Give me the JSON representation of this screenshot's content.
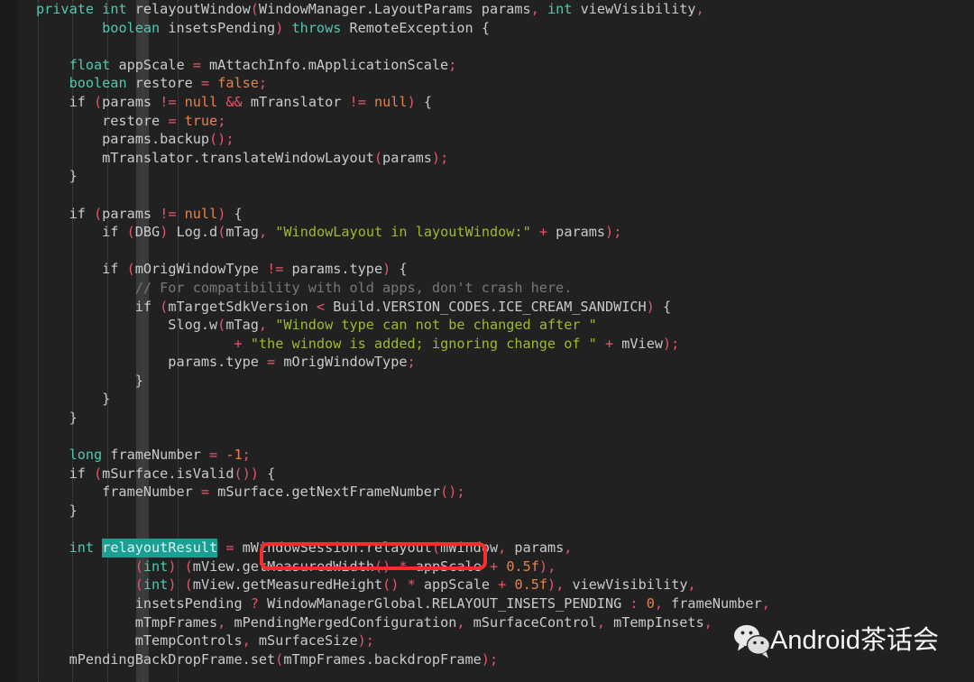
{
  "editor": {
    "background": "#212121",
    "gutter_color": "#1b1b1b",
    "vertical_bar_color": "#3a3a3a",
    "font_size_px": 15,
    "line_height_px": 20.6
  },
  "palette": {
    "keyword": "#4ec9b0",
    "punctuation": "#e8566b",
    "literal": "#e8814a",
    "string": "#9bbb2e",
    "comment": "#787878",
    "plain": "#c8cbcd",
    "selection_highlight": "#1d9e93",
    "annotation_red": "#ff2b2b"
  },
  "annotations": {
    "highlight_token": "relayoutResult",
    "boxed_expression": "mWindowSession.relayout"
  },
  "watermark": {
    "icon": "wechat-icon",
    "text": "Android茶话会",
    "color": "#ffffff"
  },
  "code": {
    "language": "java",
    "lines": [
      "private int relayoutWindow(WindowManager.LayoutParams params, int viewVisibility,",
      "        boolean insetsPending) throws RemoteException {",
      "",
      "    float appScale = mAttachInfo.mApplicationScale;",
      "    boolean restore = false;",
      "    if (params != null && mTranslator != null) {",
      "        restore = true;",
      "        params.backup();",
      "        mTranslator.translateWindowLayout(params);",
      "    }",
      "",
      "    if (params != null) {",
      "        if (DBG) Log.d(mTag, \"WindowLayout in layoutWindow:\" + params);",
      "",
      "        if (mOrigWindowType != params.type) {",
      "            // For compatibility with old apps, don't crash here.",
      "            if (mTargetSdkVersion < Build.VERSION_CODES.ICE_CREAM_SANDWICH) {",
      "                Slog.w(mTag, \"Window type can not be changed after \"",
      "                        + \"the window is added; ignoring change of \" + mView);",
      "                params.type = mOrigWindowType;",
      "            }",
      "        }",
      "    }",
      "",
      "    long frameNumber = -1;",
      "    if (mSurface.isValid()) {",
      "        frameNumber = mSurface.getNextFrameNumber();",
      "    }",
      "",
      "    int relayoutResult = mWindowSession.relayout(mWindow, params,",
      "            (int) (mView.getMeasuredWidth() * appScale + 0.5f),",
      "            (int) (mView.getMeasuredHeight() * appScale + 0.5f), viewVisibility,",
      "            insetsPending ? WindowManagerGlobal.RELAYOUT_INSETS_PENDING : 0, frameNumber,",
      "            mTmpFrames, mPendingMergedConfiguration, mSurfaceControl, mTempInsets,",
      "            mTempControls, mSurfaceSize);",
      "    mPendingBackDropFrame.set(mTmpFrames.backdropFrame);"
    ],
    "tokens": [
      [
        {
          "t": "private",
          "c": "kw"
        },
        {
          "t": " ",
          "c": "pln"
        },
        {
          "t": "int",
          "c": "kw"
        },
        {
          "t": " relayoutWindow",
          "c": "pln"
        },
        {
          "t": "(",
          "c": "punc"
        },
        {
          "t": "WindowManager.LayoutParams params",
          "c": "pln"
        },
        {
          "t": ",",
          "c": "punc"
        },
        {
          "t": " ",
          "c": "pln"
        },
        {
          "t": "int",
          "c": "kw"
        },
        {
          "t": " viewVisibility",
          "c": "pln"
        },
        {
          "t": ",",
          "c": "punc"
        }
      ],
      [
        {
          "t": "        ",
          "c": "pln"
        },
        {
          "t": "boolean",
          "c": "kw"
        },
        {
          "t": " insetsPending",
          "c": "pln"
        },
        {
          "t": ")",
          "c": "punc"
        },
        {
          "t": " ",
          "c": "pln"
        },
        {
          "t": "throws",
          "c": "kw"
        },
        {
          "t": " RemoteException {",
          "c": "pln"
        }
      ],
      [],
      [
        {
          "t": "    ",
          "c": "pln"
        },
        {
          "t": "float",
          "c": "kw"
        },
        {
          "t": " appScale ",
          "c": "pln"
        },
        {
          "t": "=",
          "c": "punc"
        },
        {
          "t": " mAttachInfo.mApplicationScale",
          "c": "pln"
        },
        {
          "t": ";",
          "c": "punc"
        }
      ],
      [
        {
          "t": "    ",
          "c": "pln"
        },
        {
          "t": "boolean",
          "c": "kw"
        },
        {
          "t": " restore ",
          "c": "pln"
        },
        {
          "t": "=",
          "c": "punc"
        },
        {
          "t": " ",
          "c": "pln"
        },
        {
          "t": "false",
          "c": "lit"
        },
        {
          "t": ";",
          "c": "punc"
        }
      ],
      [
        {
          "t": "    if ",
          "c": "pln"
        },
        {
          "t": "(",
          "c": "punc"
        },
        {
          "t": "params ",
          "c": "pln"
        },
        {
          "t": "!=",
          "c": "punc"
        },
        {
          "t": " ",
          "c": "pln"
        },
        {
          "t": "null",
          "c": "lit"
        },
        {
          "t": " ",
          "c": "pln"
        },
        {
          "t": "&&",
          "c": "punc"
        },
        {
          "t": " mTranslator ",
          "c": "pln"
        },
        {
          "t": "!=",
          "c": "punc"
        },
        {
          "t": " ",
          "c": "pln"
        },
        {
          "t": "null",
          "c": "lit"
        },
        {
          "t": ")",
          "c": "punc"
        },
        {
          "t": " {",
          "c": "pln"
        }
      ],
      [
        {
          "t": "        restore ",
          "c": "pln"
        },
        {
          "t": "=",
          "c": "punc"
        },
        {
          "t": " ",
          "c": "pln"
        },
        {
          "t": "true",
          "c": "lit"
        },
        {
          "t": ";",
          "c": "punc"
        }
      ],
      [
        {
          "t": "        params.backup",
          "c": "pln"
        },
        {
          "t": "()",
          "c": "punc"
        },
        {
          "t": ";",
          "c": "punc"
        }
      ],
      [
        {
          "t": "        mTranslator.translateWindowLayout",
          "c": "pln"
        },
        {
          "t": "(",
          "c": "punc"
        },
        {
          "t": "params",
          "c": "pln"
        },
        {
          "t": ")",
          "c": "punc"
        },
        {
          "t": ";",
          "c": "punc"
        }
      ],
      [
        {
          "t": "    }",
          "c": "pln"
        }
      ],
      [],
      [
        {
          "t": "    if ",
          "c": "pln"
        },
        {
          "t": "(",
          "c": "punc"
        },
        {
          "t": "params ",
          "c": "pln"
        },
        {
          "t": "!=",
          "c": "punc"
        },
        {
          "t": " ",
          "c": "pln"
        },
        {
          "t": "null",
          "c": "lit"
        },
        {
          "t": ")",
          "c": "punc"
        },
        {
          "t": " {",
          "c": "pln"
        }
      ],
      [
        {
          "t": "        if ",
          "c": "pln"
        },
        {
          "t": "(",
          "c": "punc"
        },
        {
          "t": "DBG",
          "c": "pln"
        },
        {
          "t": ")",
          "c": "punc"
        },
        {
          "t": " Log.d",
          "c": "pln"
        },
        {
          "t": "(",
          "c": "punc"
        },
        {
          "t": "mTag",
          "c": "pln"
        },
        {
          "t": ",",
          "c": "punc"
        },
        {
          "t": " ",
          "c": "pln"
        },
        {
          "t": "\"WindowLayout in layoutWindow:\"",
          "c": "str"
        },
        {
          "t": " ",
          "c": "pln"
        },
        {
          "t": "+",
          "c": "punc"
        },
        {
          "t": " params",
          "c": "pln"
        },
        {
          "t": ")",
          "c": "punc"
        },
        {
          "t": ";",
          "c": "punc"
        }
      ],
      [],
      [
        {
          "t": "        if ",
          "c": "pln"
        },
        {
          "t": "(",
          "c": "punc"
        },
        {
          "t": "mOrigWindowType ",
          "c": "pln"
        },
        {
          "t": "!=",
          "c": "punc"
        },
        {
          "t": " params.type",
          "c": "pln"
        },
        {
          "t": ")",
          "c": "punc"
        },
        {
          "t": " {",
          "c": "pln"
        }
      ],
      [
        {
          "t": "            // For compatibility with old apps, don't crash here.",
          "c": "cmt"
        }
      ],
      [
        {
          "t": "            if ",
          "c": "pln"
        },
        {
          "t": "(",
          "c": "punc"
        },
        {
          "t": "mTargetSdkVersion ",
          "c": "pln"
        },
        {
          "t": "<",
          "c": "punc"
        },
        {
          "t": " Build.VERSION_CODES.ICE_CREAM_SANDWICH",
          "c": "pln"
        },
        {
          "t": ")",
          "c": "punc"
        },
        {
          "t": " {",
          "c": "pln"
        }
      ],
      [
        {
          "t": "                Slog.w",
          "c": "pln"
        },
        {
          "t": "(",
          "c": "punc"
        },
        {
          "t": "mTag",
          "c": "pln"
        },
        {
          "t": ",",
          "c": "punc"
        },
        {
          "t": " ",
          "c": "pln"
        },
        {
          "t": "\"Window type can not be changed after \"",
          "c": "str"
        }
      ],
      [
        {
          "t": "                        ",
          "c": "pln"
        },
        {
          "t": "+",
          "c": "punc"
        },
        {
          "t": " ",
          "c": "pln"
        },
        {
          "t": "\"the window is added; ignoring change of \"",
          "c": "str"
        },
        {
          "t": " ",
          "c": "pln"
        },
        {
          "t": "+",
          "c": "punc"
        },
        {
          "t": " mView",
          "c": "pln"
        },
        {
          "t": ")",
          "c": "punc"
        },
        {
          "t": ";",
          "c": "punc"
        }
      ],
      [
        {
          "t": "                params.type ",
          "c": "pln"
        },
        {
          "t": "=",
          "c": "punc"
        },
        {
          "t": " mOrigWindowType",
          "c": "pln"
        },
        {
          "t": ";",
          "c": "punc"
        }
      ],
      [
        {
          "t": "            }",
          "c": "pln"
        }
      ],
      [
        {
          "t": "        }",
          "c": "pln"
        }
      ],
      [
        {
          "t": "    }",
          "c": "pln"
        }
      ],
      [],
      [
        {
          "t": "    ",
          "c": "pln"
        },
        {
          "t": "long",
          "c": "kw"
        },
        {
          "t": " frameNumber ",
          "c": "pln"
        },
        {
          "t": "=",
          "c": "punc"
        },
        {
          "t": " ",
          "c": "pln"
        },
        {
          "t": "-1",
          "c": "lit"
        },
        {
          "t": ";",
          "c": "punc"
        }
      ],
      [
        {
          "t": "    if ",
          "c": "pln"
        },
        {
          "t": "(",
          "c": "punc"
        },
        {
          "t": "mSurface.isValid",
          "c": "pln"
        },
        {
          "t": "()",
          "c": "punc"
        },
        {
          "t": ")",
          "c": "punc"
        },
        {
          "t": " {",
          "c": "pln"
        }
      ],
      [
        {
          "t": "        frameNumber ",
          "c": "pln"
        },
        {
          "t": "=",
          "c": "punc"
        },
        {
          "t": " mSurface.getNextFrameNumber",
          "c": "pln"
        },
        {
          "t": "()",
          "c": "punc"
        },
        {
          "t": ";",
          "c": "punc"
        }
      ],
      [
        {
          "t": "    }",
          "c": "pln"
        }
      ],
      [],
      [
        {
          "t": "    ",
          "c": "pln"
        },
        {
          "t": "int",
          "c": "kw"
        },
        {
          "t": " ",
          "c": "pln"
        },
        {
          "t": "relayoutResult",
          "c": "sel"
        },
        {
          "t": " ",
          "c": "pln"
        },
        {
          "t": "=",
          "c": "punc"
        },
        {
          "t": " mWindowSession.relayout",
          "c": "pln"
        },
        {
          "t": "(",
          "c": "punc"
        },
        {
          "t": "mWindow",
          "c": "pln"
        },
        {
          "t": ",",
          "c": "punc"
        },
        {
          "t": " params",
          "c": "pln"
        },
        {
          "t": ",",
          "c": "punc"
        }
      ],
      [
        {
          "t": "            ",
          "c": "pln"
        },
        {
          "t": "(",
          "c": "punc"
        },
        {
          "t": "int",
          "c": "kw"
        },
        {
          "t": ")",
          "c": "punc"
        },
        {
          "t": " ",
          "c": "pln"
        },
        {
          "t": "(",
          "c": "punc"
        },
        {
          "t": "mView.getMeasuredWidth",
          "c": "pln"
        },
        {
          "t": "()",
          "c": "punc"
        },
        {
          "t": " ",
          "c": "pln"
        },
        {
          "t": "*",
          "c": "punc"
        },
        {
          "t": " appScale ",
          "c": "pln"
        },
        {
          "t": "+",
          "c": "punc"
        },
        {
          "t": " ",
          "c": "pln"
        },
        {
          "t": "0.5f",
          "c": "lit"
        },
        {
          "t": ")",
          "c": "punc"
        },
        {
          "t": ",",
          "c": "punc"
        }
      ],
      [
        {
          "t": "            ",
          "c": "pln"
        },
        {
          "t": "(",
          "c": "punc"
        },
        {
          "t": "int",
          "c": "kw"
        },
        {
          "t": ")",
          "c": "punc"
        },
        {
          "t": " ",
          "c": "pln"
        },
        {
          "t": "(",
          "c": "punc"
        },
        {
          "t": "mView.getMeasuredHeight",
          "c": "pln"
        },
        {
          "t": "()",
          "c": "punc"
        },
        {
          "t": " ",
          "c": "pln"
        },
        {
          "t": "*",
          "c": "punc"
        },
        {
          "t": " appScale ",
          "c": "pln"
        },
        {
          "t": "+",
          "c": "punc"
        },
        {
          "t": " ",
          "c": "pln"
        },
        {
          "t": "0.5f",
          "c": "lit"
        },
        {
          "t": ")",
          "c": "punc"
        },
        {
          "t": ",",
          "c": "punc"
        },
        {
          "t": " viewVisibility",
          "c": "pln"
        },
        {
          "t": ",",
          "c": "punc"
        }
      ],
      [
        {
          "t": "            insetsPending ",
          "c": "pln"
        },
        {
          "t": "?",
          "c": "punc"
        },
        {
          "t": " WindowManagerGlobal.RELAYOUT_INSETS_PENDING ",
          "c": "pln"
        },
        {
          "t": ":",
          "c": "punc"
        },
        {
          "t": " ",
          "c": "pln"
        },
        {
          "t": "0",
          "c": "lit"
        },
        {
          "t": ",",
          "c": "punc"
        },
        {
          "t": " frameNumber",
          "c": "pln"
        },
        {
          "t": ",",
          "c": "punc"
        }
      ],
      [
        {
          "t": "            mTmpFrames",
          "c": "pln"
        },
        {
          "t": ",",
          "c": "punc"
        },
        {
          "t": " mPendingMergedConfiguration",
          "c": "pln"
        },
        {
          "t": ",",
          "c": "punc"
        },
        {
          "t": " mSurfaceControl",
          "c": "pln"
        },
        {
          "t": ",",
          "c": "punc"
        },
        {
          "t": " mTempInsets",
          "c": "pln"
        },
        {
          "t": ",",
          "c": "punc"
        }
      ],
      [
        {
          "t": "            mTempControls",
          "c": "pln"
        },
        {
          "t": ",",
          "c": "punc"
        },
        {
          "t": " mSurfaceSize",
          "c": "pln"
        },
        {
          "t": ")",
          "c": "punc"
        },
        {
          "t": ";",
          "c": "punc"
        }
      ],
      [
        {
          "t": "    mPendingBackDropFrame.set",
          "c": "pln"
        },
        {
          "t": "(",
          "c": "punc"
        },
        {
          "t": "mTmpFrames.backdropFrame",
          "c": "pln"
        },
        {
          "t": ")",
          "c": "punc"
        },
        {
          "t": ";",
          "c": "punc"
        }
      ]
    ]
  }
}
